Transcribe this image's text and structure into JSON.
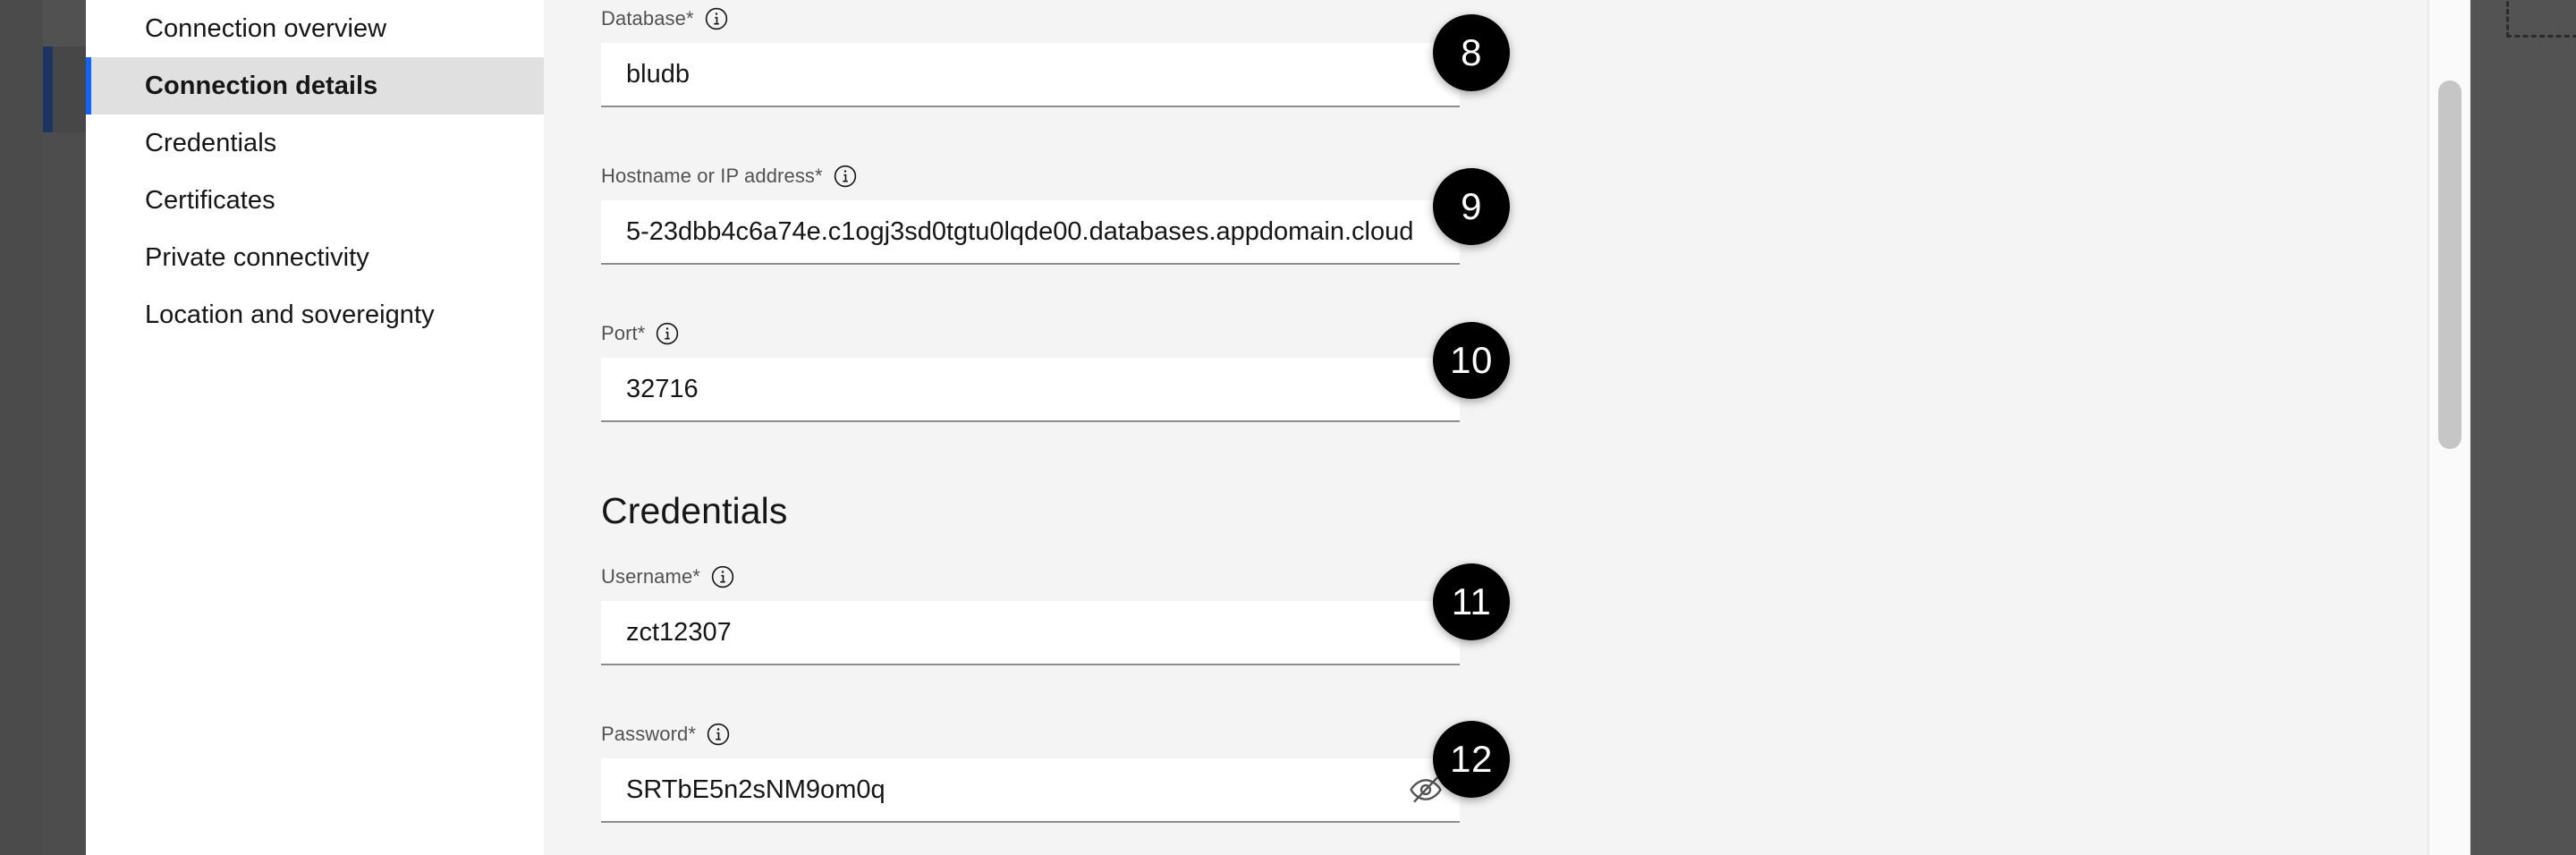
{
  "nav": {
    "items": [
      {
        "label": "Connection overview",
        "selected": false
      },
      {
        "label": "Connection details",
        "selected": true
      },
      {
        "label": "Credentials",
        "selected": false
      },
      {
        "label": "Certificates",
        "selected": false
      },
      {
        "label": "Private connectivity",
        "selected": false
      },
      {
        "label": "Location and sovereignty",
        "selected": false
      }
    ]
  },
  "form": {
    "fields": {
      "database": {
        "label": "Database*",
        "value": "bludb",
        "info_icon": "information-icon",
        "badge": "8"
      },
      "hostname": {
        "label": "Hostname or IP address*",
        "value": "5-23dbb4c6a74e.c1ogj3sd0tgtu0lqde00.databases.appdomain.cloud",
        "info_icon": "information-icon",
        "badge": "9"
      },
      "port": {
        "label": "Port*",
        "value": "32716",
        "info_icon": "information-icon",
        "badge": "10"
      },
      "username": {
        "label": "Username*",
        "value": "zct12307",
        "info_icon": "information-icon",
        "badge": "11"
      },
      "password": {
        "label": "Password*",
        "value": "SRTbE5n2sNM9om0q",
        "info_icon": "information-icon",
        "toggle_icon": "eye-slash-icon",
        "badge": "12"
      }
    },
    "credentials_heading": "Credentials"
  },
  "colors": {
    "selection_accent": "#0f62fe",
    "nav_selected_bg": "#e0e0e0",
    "content_bg": "#f4f4f4",
    "field_bg": "#ffffff",
    "field_underline": "#8d8d8d",
    "label_text": "#525252",
    "value_text": "#161616",
    "badge_bg": "#000000",
    "badge_text": "#ffffff",
    "backdrop_dark": "#4d4d4d",
    "scrollbar_thumb": "#c6c6c6"
  }
}
